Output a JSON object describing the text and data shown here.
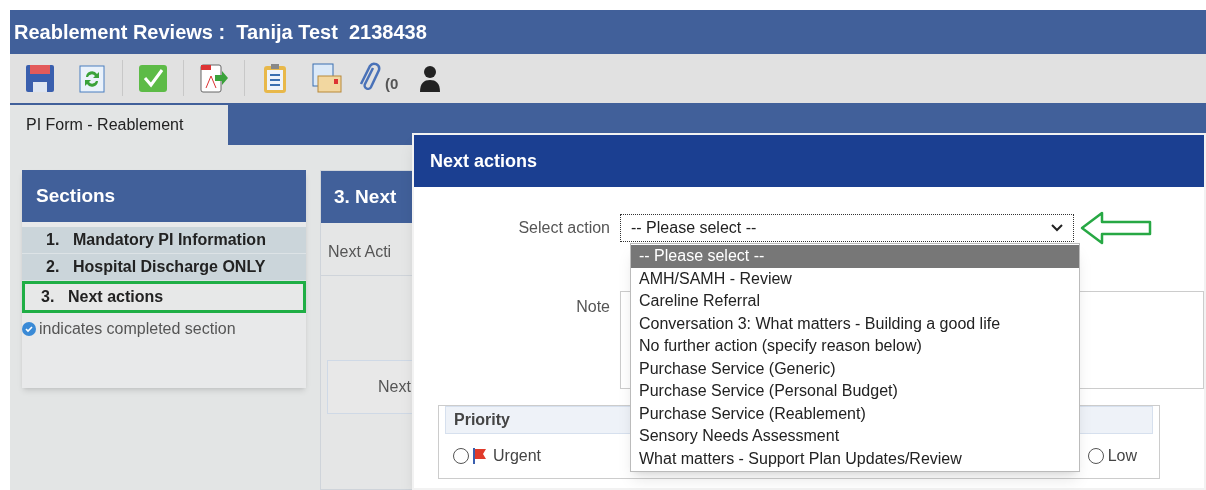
{
  "window": {
    "title": "Reablement Reviews :  Tanija Test  2138438"
  },
  "toolbar": {
    "attachment_count": "(0"
  },
  "tabs": [
    {
      "label": "PI Form - Reablement",
      "selected": true
    }
  ],
  "sections": {
    "title": "Sections",
    "legend": "indicates completed section",
    "items": [
      {
        "number": "1.",
        "label": "Mandatory PI Information",
        "selected": false
      },
      {
        "number": "2.",
        "label": "Hospital Discharge ONLY",
        "selected": false
      },
      {
        "number": "3.",
        "label": "Next actions",
        "selected": true
      }
    ]
  },
  "background_panel": {
    "title": "3. Next",
    "column": "Next Acti",
    "button": "Next"
  },
  "dialog": {
    "title": "Next actions",
    "select_label": "Select action",
    "select_value": "-- Please select --",
    "note_label": "Note",
    "options": [
      {
        "label": "-- Please select --",
        "selected": true
      },
      {
        "label": "AMH/SAMH - Review",
        "selected": false
      },
      {
        "label": "Careline Referral",
        "selected": false
      },
      {
        "label": "Conversation 3: What matters - Building a good life",
        "selected": false
      },
      {
        "label": "No further action (specify reason below)",
        "selected": false
      },
      {
        "label": "Purchase Service (Generic)",
        "selected": false
      },
      {
        "label": "Purchase Service (Personal Budget)",
        "selected": false
      },
      {
        "label": "Purchase Service (Reablement)",
        "selected": false
      },
      {
        "label": "Sensory Needs Assessment",
        "selected": false
      },
      {
        "label": "What matters - Support Plan Updates/Review",
        "selected": false
      }
    ],
    "priority": {
      "title": "Priority",
      "options": [
        {
          "label": "Urgent",
          "selected": false
        },
        {
          "label": "Low",
          "selected": false
        }
      ]
    }
  }
}
